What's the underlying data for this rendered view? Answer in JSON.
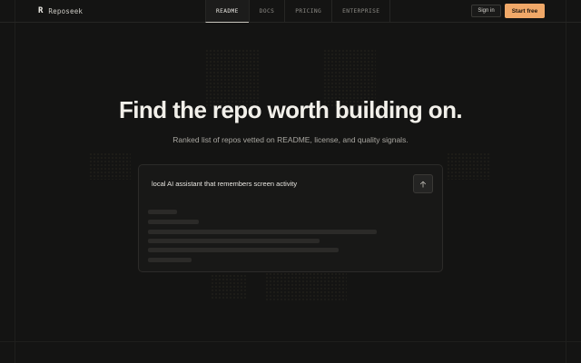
{
  "header": {
    "brand_mark": "R",
    "brand_name": "Reposeek",
    "nav": [
      {
        "label": "README",
        "active": true
      },
      {
        "label": "DOCS",
        "active": false
      },
      {
        "label": "PRICING",
        "active": false
      },
      {
        "label": "ENTERPRISE",
        "active": false
      }
    ],
    "signin_label": "Sign in",
    "start_label": "Start free"
  },
  "hero": {
    "title": "Find the repo worth building on.",
    "subtitle": "Ranked list of repos vetted on README, license, and quality signals."
  },
  "search": {
    "query": "local AI assistant that remembers screen activity",
    "submit_icon": "arrow-up-icon",
    "results_loading": true
  },
  "colors": {
    "background": "#141413",
    "accent": "#f0a868",
    "text": "#f2f0ea",
    "muted": "#a9a7a1"
  }
}
